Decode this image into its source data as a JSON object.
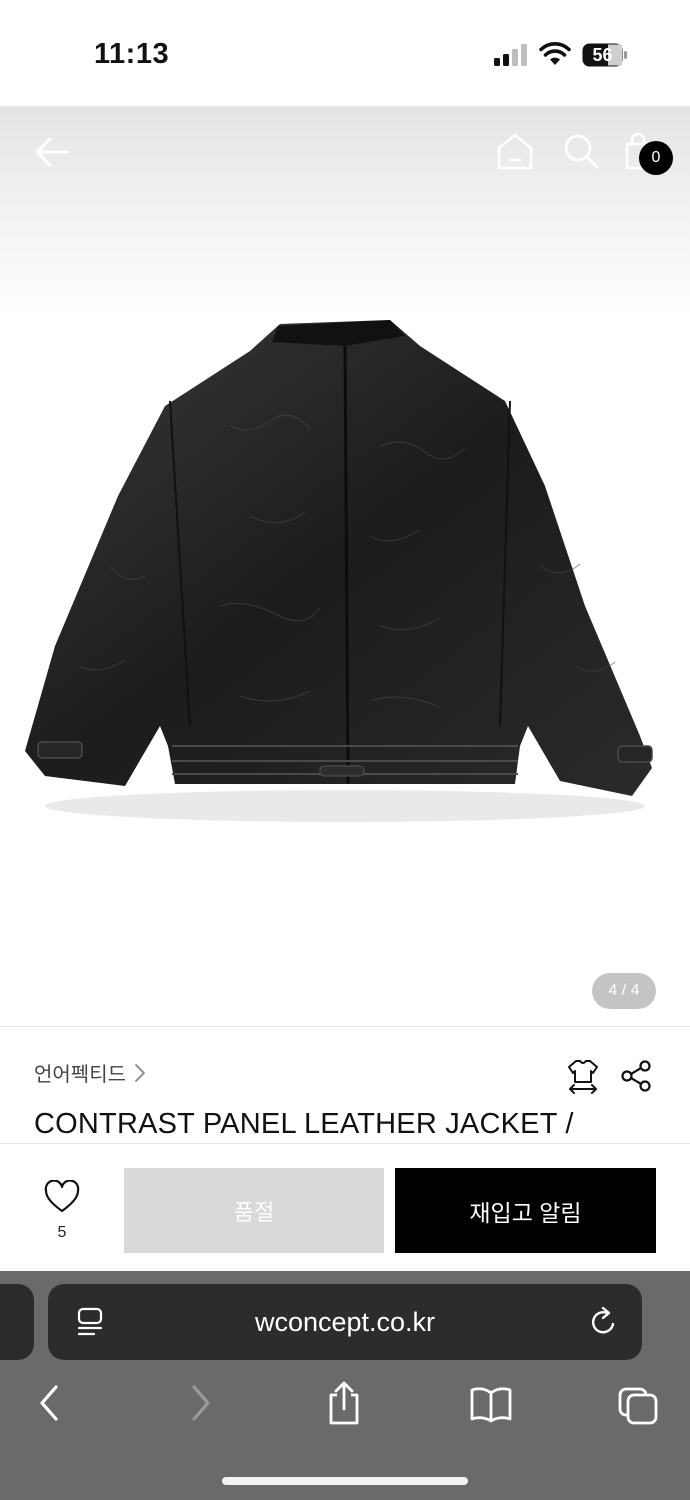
{
  "status_bar": {
    "time": "11:13",
    "battery": "56"
  },
  "header": {
    "cart_count": "0"
  },
  "gallery": {
    "indicator": "4 / 4"
  },
  "product": {
    "brand": "언어펙티드",
    "title": "CONTRAST PANEL LEATHER JACKET /"
  },
  "actions": {
    "like_count": "5",
    "soldout_label": "품절",
    "restock_label": "재입고 알림"
  },
  "browser": {
    "url": "wconcept.co.kr"
  },
  "colors": {
    "accent": "#000000",
    "soldout_bg": "#d9d9d9",
    "safari_bg": "#6a6a6a"
  }
}
